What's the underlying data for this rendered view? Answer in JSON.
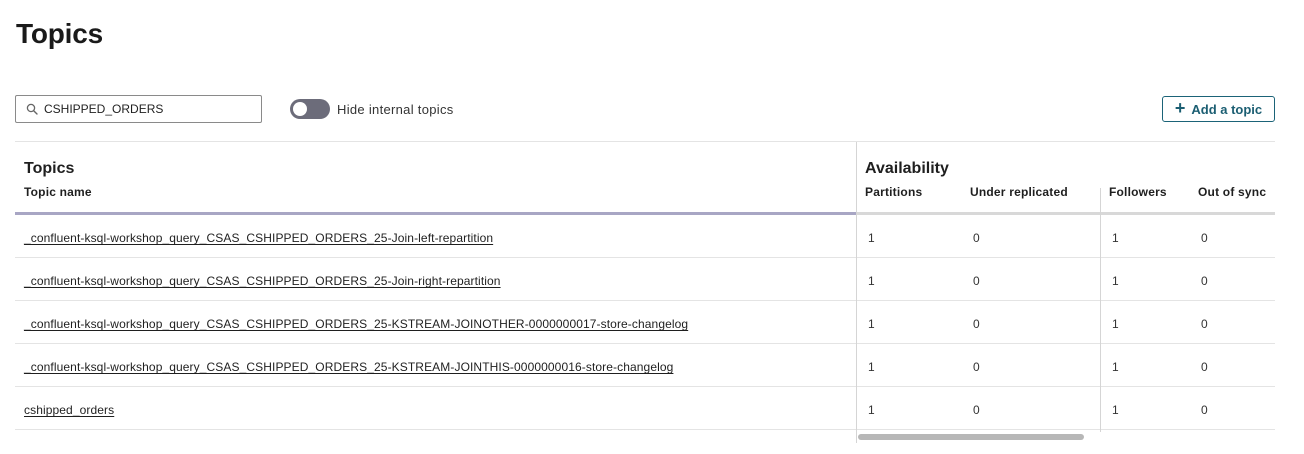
{
  "page": {
    "title": "Topics"
  },
  "search": {
    "value": "CSHIPPED_ORDERS"
  },
  "toggle": {
    "label": "Hide internal topics",
    "state": "off"
  },
  "actions": {
    "add_topic": "Add a topic",
    "add_icon": "plus-icon"
  },
  "table": {
    "group_topics": "Topics",
    "group_availability": "Availability",
    "columns": {
      "topic_name": "Topic name",
      "partitions": "Partitions",
      "under_replicated": "Under replicated",
      "followers": "Followers",
      "out_of_sync": "Out of sync"
    },
    "rows": [
      {
        "name": "_confluent-ksql-workshop_query_CSAS_CSHIPPED_ORDERS_25-Join-left-repartition",
        "partitions": "1",
        "under_replicated": "0",
        "followers": "1",
        "out_of_sync": "0"
      },
      {
        "name": "_confluent-ksql-workshop_query_CSAS_CSHIPPED_ORDERS_25-Join-right-repartition",
        "partitions": "1",
        "under_replicated": "0",
        "followers": "1",
        "out_of_sync": "0"
      },
      {
        "name": "_confluent-ksql-workshop_query_CSAS_CSHIPPED_ORDERS_25-KSTREAM-JOINOTHER-0000000017-store-changelog",
        "partitions": "1",
        "under_replicated": "0",
        "followers": "1",
        "out_of_sync": "0"
      },
      {
        "name": "_confluent-ksql-workshop_query_CSAS_CSHIPPED_ORDERS_25-KSTREAM-JOINTHIS-0000000016-store-changelog",
        "partitions": "1",
        "under_replicated": "0",
        "followers": "1",
        "out_of_sync": "0"
      },
      {
        "name": "cshipped_orders",
        "partitions": "1",
        "under_replicated": "0",
        "followers": "1",
        "out_of_sync": "0"
      }
    ]
  },
  "colors": {
    "accent": "#1b5e72",
    "toggle_off": "#6c6c7a",
    "header_underline": "#a8a6c4"
  }
}
